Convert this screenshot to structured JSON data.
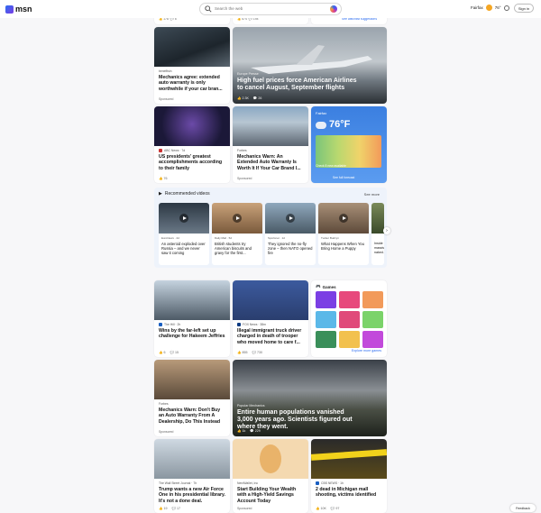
{
  "header": {
    "brand": "msn",
    "search_placeholder": "Search the web",
    "location": "Fairfax",
    "temperature": "76°",
    "sign_in": "Sign in"
  },
  "top_strip": {
    "card1_meta": [
      "178",
      "6"
    ],
    "card2_meta": [
      "574",
      "194"
    ],
    "see_suggestions": "See watchlist suggestions"
  },
  "cards": {
    "warranty1": {
      "source": "benefitsin",
      "title": "Mechanics agree: extended auto warranty is only worthwhile if your car bran...",
      "sponsored": "Sponsored"
    },
    "airlines": {
      "source": "Europe Presse",
      "title": "High fuel prices force American Airlines to cancel August, September flights",
      "meta": [
        "2.3K",
        "26"
      ]
    },
    "presidents": {
      "source": "ABC News · 7d",
      "title": "US presidents' greatest accomplishments according to their family",
      "meta": [
        "76"
      ]
    },
    "warranty2": {
      "source": "Forbes",
      "title": "Mechanics Warn: An Extended Auto Warranty Is Worth It If Your Car Brand I...",
      "sponsored": "Sponsored"
    },
    "wins": {
      "source": "The Hill · 2h",
      "title": "Wins by the far-left set up challenge for Hakeem Jeffries",
      "meta": [
        "6",
        "15"
      ]
    },
    "truck": {
      "source": "FOX News · 38m",
      "title": "Illegal immigrant truck driver charged in death of trooper who moved home to care f...",
      "meta": [
        "855",
        "730"
      ]
    },
    "warranty3": {
      "source": "Forbes",
      "title": "Mechanics Warn: Don't Buy an Auto Warranty From A Dealership, Do This Instead",
      "sponsored": "Sponsored"
    },
    "populations": {
      "source": "Popular Mechanics",
      "title": "Entire human populations vanished 3,000 years ago. Scientists figured out where they went.",
      "meta": [
        "1k",
        "229"
      ]
    },
    "airforce": {
      "source": "The Wall Street Journal · 7h",
      "title": "Trump wants a new Air Force One in his presidential library. It's not a done deal.",
      "meta": [
        "19",
        "17"
      ]
    },
    "wealth": {
      "source": "NerdWallet, Inc",
      "title": "Start Building Your Wealth with a High-Yield Savings Account Today",
      "sponsored": "Sponsored"
    },
    "mall": {
      "source": "CBS NEWS · 1h",
      "title": "2 dead in Michigan mall shooting, victims identified",
      "meta": [
        "10K",
        "97"
      ]
    }
  },
  "weather": {
    "location": "Fairfax",
    "temp": "76°F",
    "alert": "Check 8 new available",
    "link": "See full forecast"
  },
  "recommended": {
    "title": "Recommended videos",
    "more": "See more",
    "videos": [
      {
        "source": "EuroNews · 2d",
        "title": "An asteroid exploded over Russia – and we never saw it coming"
      },
      {
        "source": "Daily Mail · 5d",
        "title": "British students try American biscuits and gravy for the first..."
      },
      {
        "source": "Sportsnet · 1d",
        "title": "They ignored the no-fly zone – then NATO opened fire"
      },
      {
        "source": "Tucker Budzyn",
        "title": "What Happens When You Bring Home a Puppy"
      },
      {
        "source": "",
        "title": "Inside massive naked..."
      }
    ]
  },
  "games": {
    "title": "Games",
    "explore": "Explore more games",
    "colors": [
      "#7b3fe4",
      "#e7497c",
      "#f29a5a",
      "#5bb8e8",
      "#e04a7a",
      "#7bd36a",
      "#3a8f5a",
      "#f2c14e",
      "#c24adb"
    ]
  },
  "feedback": "Feedback"
}
